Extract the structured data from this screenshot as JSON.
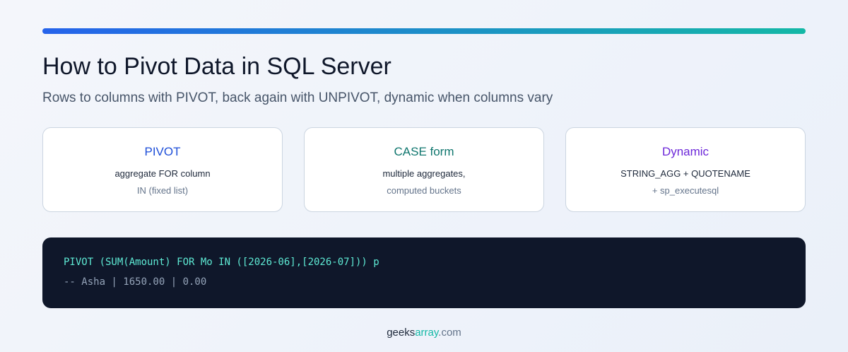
{
  "title": "How to Pivot Data in SQL Server",
  "subtitle": "Rows to columns with PIVOT, back again with UNPIVOT, dynamic when columns vary",
  "cards": [
    {
      "title": "PIVOT",
      "line1": "aggregate FOR column",
      "line2": "IN (fixed list)",
      "color": "#1d4ed8"
    },
    {
      "title": "CASE form",
      "line1": "multiple aggregates,",
      "line2": "computed buckets",
      "color": "#0f766e"
    },
    {
      "title": "Dynamic",
      "line1": "STRING_AGG + QUOTENAME",
      "line2": "+ sp_executesql",
      "color": "#6d28d9"
    }
  ],
  "code": {
    "line1": "PIVOT (SUM(Amount) FOR Mo IN ([2026-06],[2026-07])) p",
    "line2": "-- Asha | 1650.00 | 0.00"
  },
  "footer": {
    "part1": "geeks",
    "part2": "array",
    "part3": ".com",
    "color_main": "#1e293b",
    "color_accent": "#14b8a6",
    "color_muted": "#64748b"
  },
  "accent_gradient": [
    "#2563eb",
    "#14b8a6"
  ]
}
